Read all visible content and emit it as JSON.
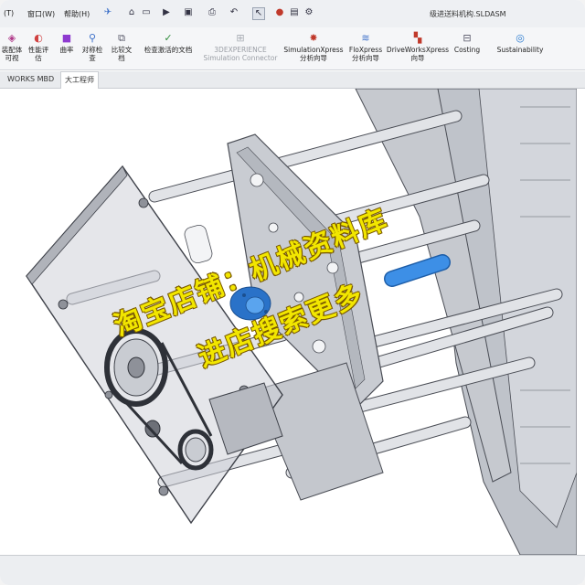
{
  "menu": {
    "items": [
      "(T)",
      "窗口(W)",
      "帮助(H)"
    ],
    "pin_icon": "pin-icon"
  },
  "quick_access": [
    "home-icon",
    "new-file-icon",
    "open-icon",
    "save-icon",
    "print-icon",
    "undo-icon",
    "select-icon",
    "traffic-light-icon",
    "file-properties-icon",
    "options-icon"
  ],
  "document_title": "级进送料机构.SLDASM",
  "ribbon": {
    "buttons": [
      {
        "label": "装配体\n可视",
        "icon": "assembly-visualization-icon"
      },
      {
        "label": "性能评\n估",
        "icon": "performance-evaluation-icon"
      },
      {
        "label": "曲率",
        "icon": "curvature-icon"
      },
      {
        "label": "对称检\n查",
        "icon": "symmetry-check-icon"
      },
      {
        "label": "比较文\n档",
        "icon": "compare-documents-icon"
      },
      {
        "label": "检查激活的文档",
        "icon": "check-active-document-icon"
      },
      {
        "label": "3DEXPERIENCE\nSimulation Connector",
        "icon": "simulation-connector-icon",
        "disabled": true
      },
      {
        "label": "SimulationXpress\n分析向导",
        "icon": "simulationxpress-icon"
      },
      {
        "label": "FloXpress\n分析向导",
        "icon": "floxpress-icon"
      },
      {
        "label": "DriveWorksXpress\n向导",
        "icon": "driveworksxpress-icon"
      },
      {
        "label": "Costing",
        "icon": "costing-icon"
      },
      {
        "label": "Sustainability",
        "icon": "sustainability-icon"
      }
    ]
  },
  "tabs": [
    {
      "label": "WORKS MBD",
      "active": false
    },
    {
      "label": "大工程师",
      "active": true
    }
  ],
  "view_tools": [
    "zoom-to-fit-icon",
    "zoom-area-icon",
    "previous-view-icon",
    "section-view-icon",
    "dynamic-annotation-icon",
    "view-orientation-icon",
    "display-style-icon",
    "hide-show-icon",
    "appearance-icon",
    "scene-icon",
    "view-settings-icon"
  ],
  "watermark": {
    "line1": "淘宝店铺：机械资料库",
    "line2": "进店搜索更多"
  },
  "colors": {
    "plate": "#c9ccd2",
    "plate_edge": "#4a4d55",
    "rod": "#d8dadf",
    "blue_part": "#3d8fe6",
    "watermark": "#f2e600"
  }
}
